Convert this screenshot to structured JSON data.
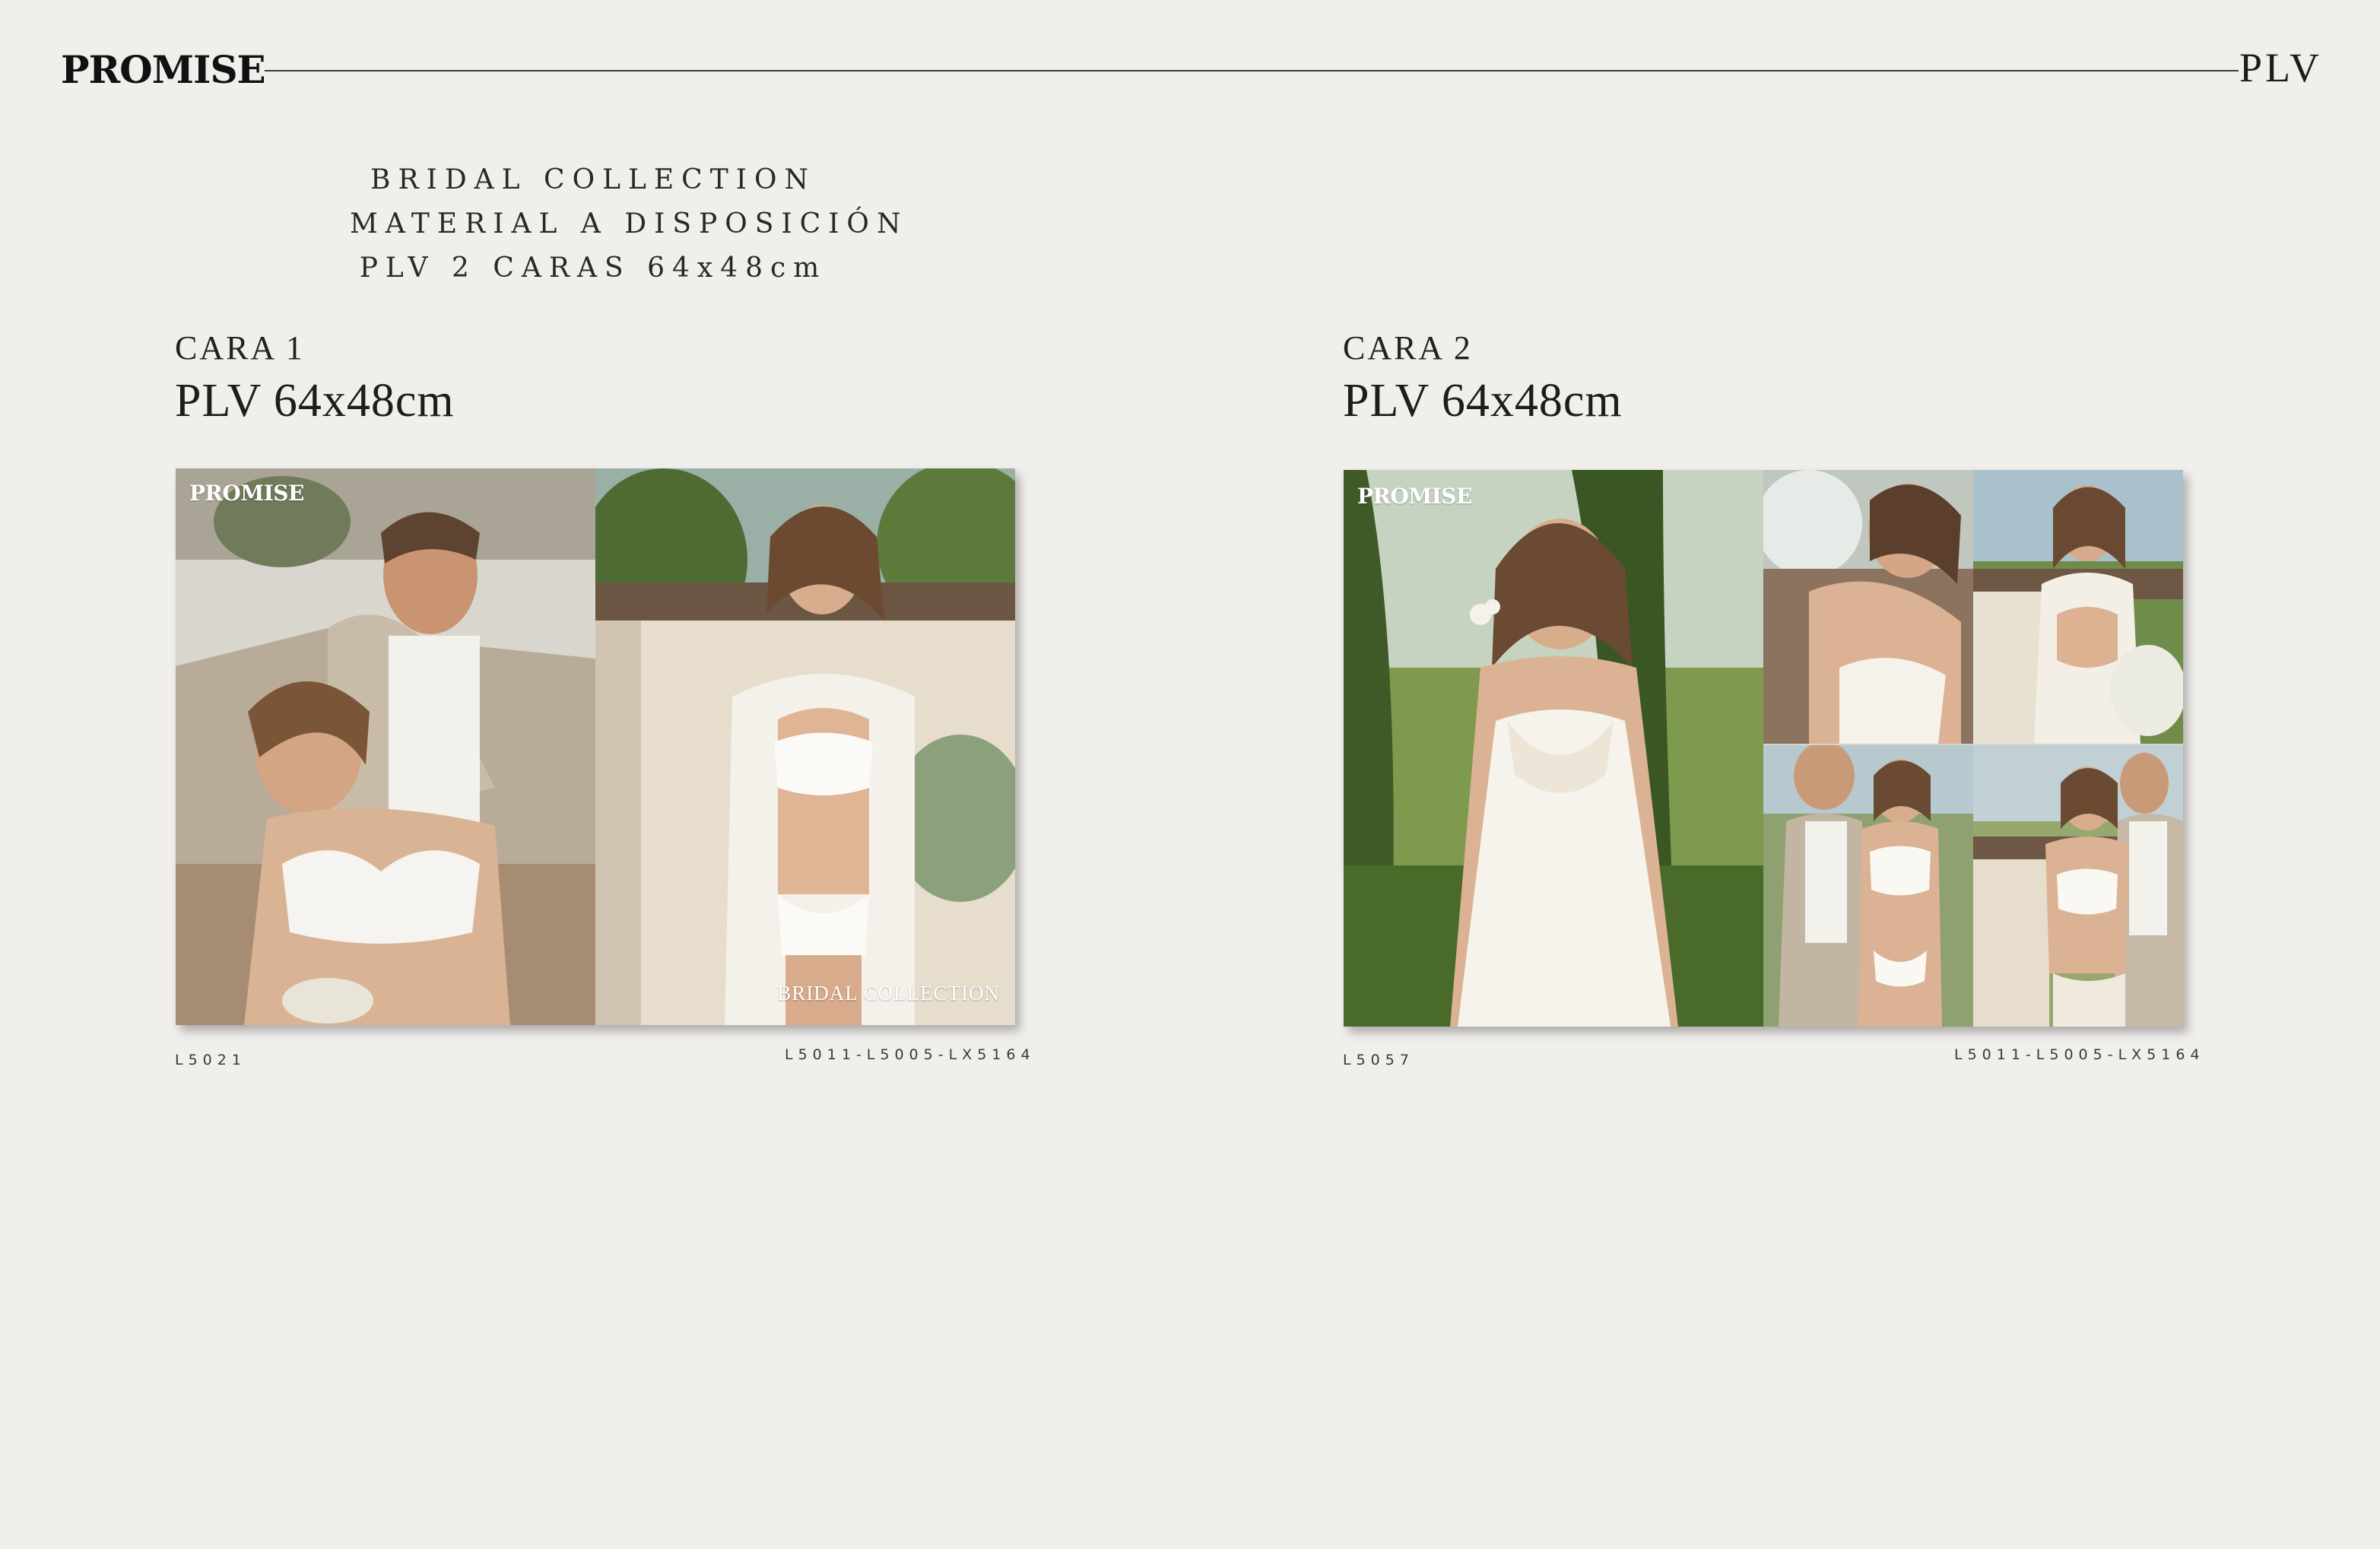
{
  "header": {
    "brand": "PROMISE",
    "section": "PLV"
  },
  "intro": {
    "lines": [
      "BRIDAL COLLECTION",
      "MATERIAL A DISPOSICIÓN",
      "PLV 2 CARAS 64x48cm"
    ]
  },
  "faces": [
    {
      "label": "CARA 1",
      "size": "PLV 64x48cm",
      "overlay_logo": "PROMISE",
      "overlay_caption": "BRIDAL COLLECTION",
      "code_left": "L5021",
      "code_right": "L5011-L5005-LX5164"
    },
    {
      "label": "CARA 2",
      "size": "PLV 64x48cm",
      "overlay_logo": "PROMISE",
      "code_left": "L5057",
      "code_right": "L5011-L5005-LX5164"
    }
  ],
  "colors": {
    "background": "#f1efec",
    "text": "#1d1b19",
    "rule": "#3b3935",
    "overlay_text": "#ffffff"
  }
}
